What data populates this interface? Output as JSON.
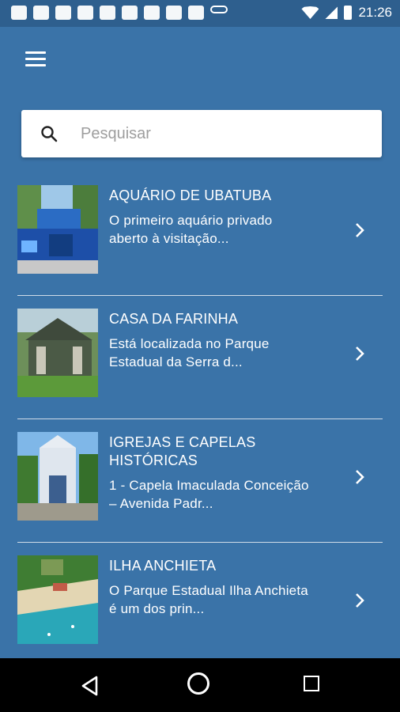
{
  "status": {
    "time": "21:26"
  },
  "search": {
    "placeholder": "Pesquisar"
  },
  "items": [
    {
      "title": "AQUÁRIO DE UBATUBA",
      "desc_line1": "O primeiro aquário privado",
      "desc_line2": "aberto à visitação..."
    },
    {
      "title": "CASA DA FARINHA",
      "desc_line1": "Está localizada no Parque",
      "desc_line2": "Estadual da Serra d..."
    },
    {
      "title": "IGREJAS E CAPELAS HISTÓRICAS",
      "desc_line1": "1 - Capela Imaculada Conceição",
      "desc_line2": "– Avenida Padr..."
    },
    {
      "title": "ILHA ANCHIETA",
      "desc_line1": "O Parque Estadual Ilha Anchieta",
      "desc_line2": "é um dos prin..."
    }
  ],
  "colors": {
    "background": "#3a73a8",
    "statusbar": "#2e5f8e",
    "navbar": "#000000"
  }
}
